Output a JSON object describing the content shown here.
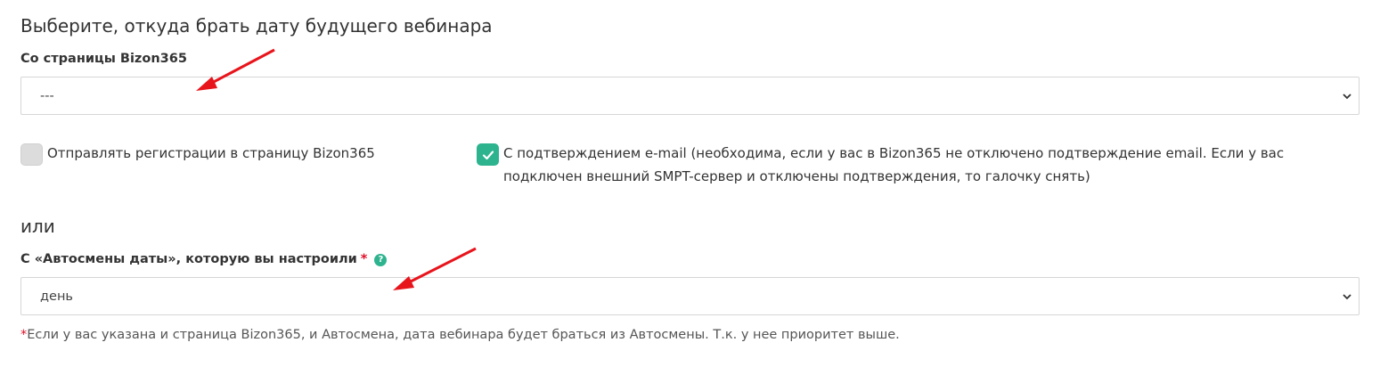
{
  "heading": "Выберите, откуда брать дату будущего вебинара",
  "section1": {
    "label": "Со страницы Bizon365",
    "select_value": "---"
  },
  "checkboxes": [
    {
      "label": "Отправлять регистрации в страницу Bizon365",
      "checked": false
    },
    {
      "label": "С подтверждением e-mail (необходима, если у вас в Bizon365 не отключено подтверждение email. Если у вас подключен внешний SMPT-сервер и отключены подтверждения, то галочку снять)",
      "checked": true
    }
  ],
  "or_text": "или",
  "section2": {
    "label": "С «Автосмены даты», которую вы настроили",
    "required_mark": "*",
    "help_icon": "?",
    "select_value": "день"
  },
  "note": {
    "star": "*",
    "text": "Если у вас указана и страница Bizon365, и Автосмена, дата вебинара будет браться из Автосмены. Т.к. у нее приоритет выше."
  },
  "colors": {
    "accent": "#2eb38f",
    "required": "#e0102a",
    "annotation_arrow": "#e8141c"
  }
}
